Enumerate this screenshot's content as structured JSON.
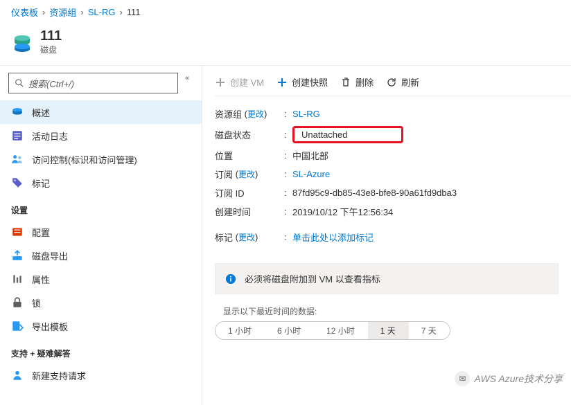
{
  "breadcrumb": {
    "items": [
      "仪表板",
      "资源组",
      "SL-RG",
      "111"
    ]
  },
  "header": {
    "title": "111",
    "subtitle": "磁盘"
  },
  "search": {
    "placeholder": "搜索(Ctrl+/)"
  },
  "nav": {
    "overview": "概述",
    "activity_log": "活动日志",
    "access_control": "访问控制(标识和访问管理)",
    "tags": "标记",
    "section_settings": "设置",
    "config": "配置",
    "disk_export": "磁盘导出",
    "properties": "属性",
    "locks": "锁",
    "export_template": "导出模板",
    "section_support": "支持 + 疑难解答",
    "new_support": "新建支持请求"
  },
  "toolbar": {
    "create_vm": "创建 VM",
    "create_snapshot": "创建快照",
    "delete": "删除",
    "refresh": "刷新"
  },
  "props": {
    "resource_group_label": "资源组",
    "resource_group_value": "SL-RG",
    "change": "更改",
    "status_label": "磁盘状态",
    "status_value": "Unattached",
    "location_label": "位置",
    "location_value": "中国北部",
    "subscription_label": "订阅",
    "subscription_value": "SL-Azure",
    "subscription_id_label": "订阅 ID",
    "subscription_id_value": "87fd95c9-db85-43e8-bfe8-90a61fd9dba3",
    "created_label": "创建时间",
    "created_value": "2019/10/12 下午12:56:34",
    "tags_label": "标记",
    "tags_value": "单击此处以添加标记"
  },
  "info": {
    "message": "必须将磁盘附加到 VM 以查看指标"
  },
  "chart": {
    "label": "显示以下最近时间的数据:",
    "pills": [
      "1 小时",
      "6 小时",
      "12 小时",
      "1 天",
      "7 天"
    ],
    "selected_index": 3
  },
  "watermark": {
    "text": "AWS Azure技术分享"
  }
}
